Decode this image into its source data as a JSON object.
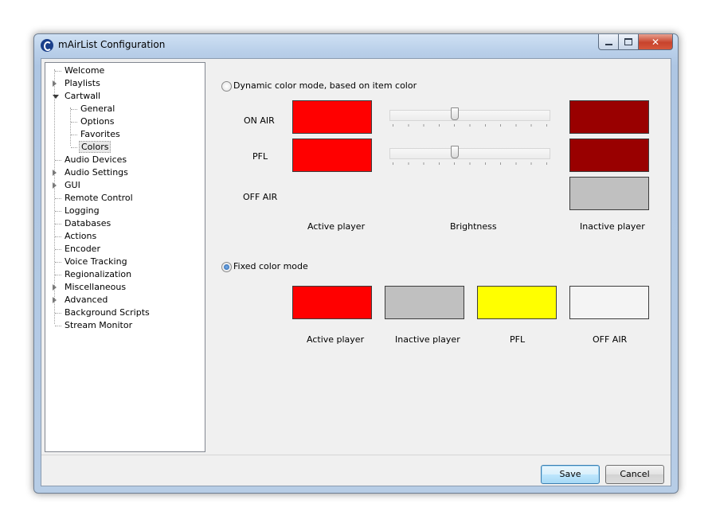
{
  "window": {
    "title": "mAirList Configuration"
  },
  "tree": {
    "items": [
      {
        "label": "Welcome",
        "level": 0,
        "expander": "none"
      },
      {
        "label": "Playlists",
        "level": 0,
        "expander": "closed"
      },
      {
        "label": "Cartwall",
        "level": 0,
        "expander": "open"
      },
      {
        "label": "General",
        "level": 1,
        "expander": "none"
      },
      {
        "label": "Options",
        "level": 1,
        "expander": "none"
      },
      {
        "label": "Favorites",
        "level": 1,
        "expander": "none"
      },
      {
        "label": "Colors",
        "level": 1,
        "expander": "none",
        "selected": true
      },
      {
        "label": "Audio Devices",
        "level": 0,
        "expander": "none"
      },
      {
        "label": "Audio Settings",
        "level": 0,
        "expander": "closed"
      },
      {
        "label": "GUI",
        "level": 0,
        "expander": "closed"
      },
      {
        "label": "Remote Control",
        "level": 0,
        "expander": "none"
      },
      {
        "label": "Logging",
        "level": 0,
        "expander": "none"
      },
      {
        "label": "Databases",
        "level": 0,
        "expander": "none"
      },
      {
        "label": "Actions",
        "level": 0,
        "expander": "none"
      },
      {
        "label": "Encoder",
        "level": 0,
        "expander": "none"
      },
      {
        "label": "Voice Tracking",
        "level": 0,
        "expander": "none"
      },
      {
        "label": "Regionalization",
        "level": 0,
        "expander": "none"
      },
      {
        "label": "Miscellaneous",
        "level": 0,
        "expander": "closed"
      },
      {
        "label": "Advanced",
        "level": 0,
        "expander": "closed"
      },
      {
        "label": "Background Scripts",
        "level": 0,
        "expander": "none"
      },
      {
        "label": "Stream Monitor",
        "level": 0,
        "expander": "none"
      }
    ]
  },
  "dynamic": {
    "radio_label": "Dynamic color mode, based on item color",
    "selected": false,
    "rows": {
      "on_air": {
        "label": "ON AIR",
        "active_color": "#ff0000",
        "inactive_color": "#990000",
        "brightness": 0.4
      },
      "pfl": {
        "label": "PFL",
        "active_color": "#ff0000",
        "inactive_color": "#990000",
        "brightness": 0.4
      },
      "off_air": {
        "label": "OFF AIR",
        "inactive_color": "#c0c0c0"
      }
    },
    "col_active": "Active player",
    "col_brightness": "Brightness",
    "col_inactive": "Inactive player"
  },
  "fixed": {
    "radio_label": "Fixed color mode",
    "selected": true,
    "swatches": [
      {
        "label": "Active player",
        "color": "#ff0000"
      },
      {
        "label": "Inactive player",
        "color": "#c0c0c0"
      },
      {
        "label": "PFL",
        "color": "#ffff00"
      },
      {
        "label": "OFF AIR",
        "color": "#f4f4f4"
      }
    ]
  },
  "buttons": {
    "save": "Save",
    "cancel": "Cancel"
  }
}
